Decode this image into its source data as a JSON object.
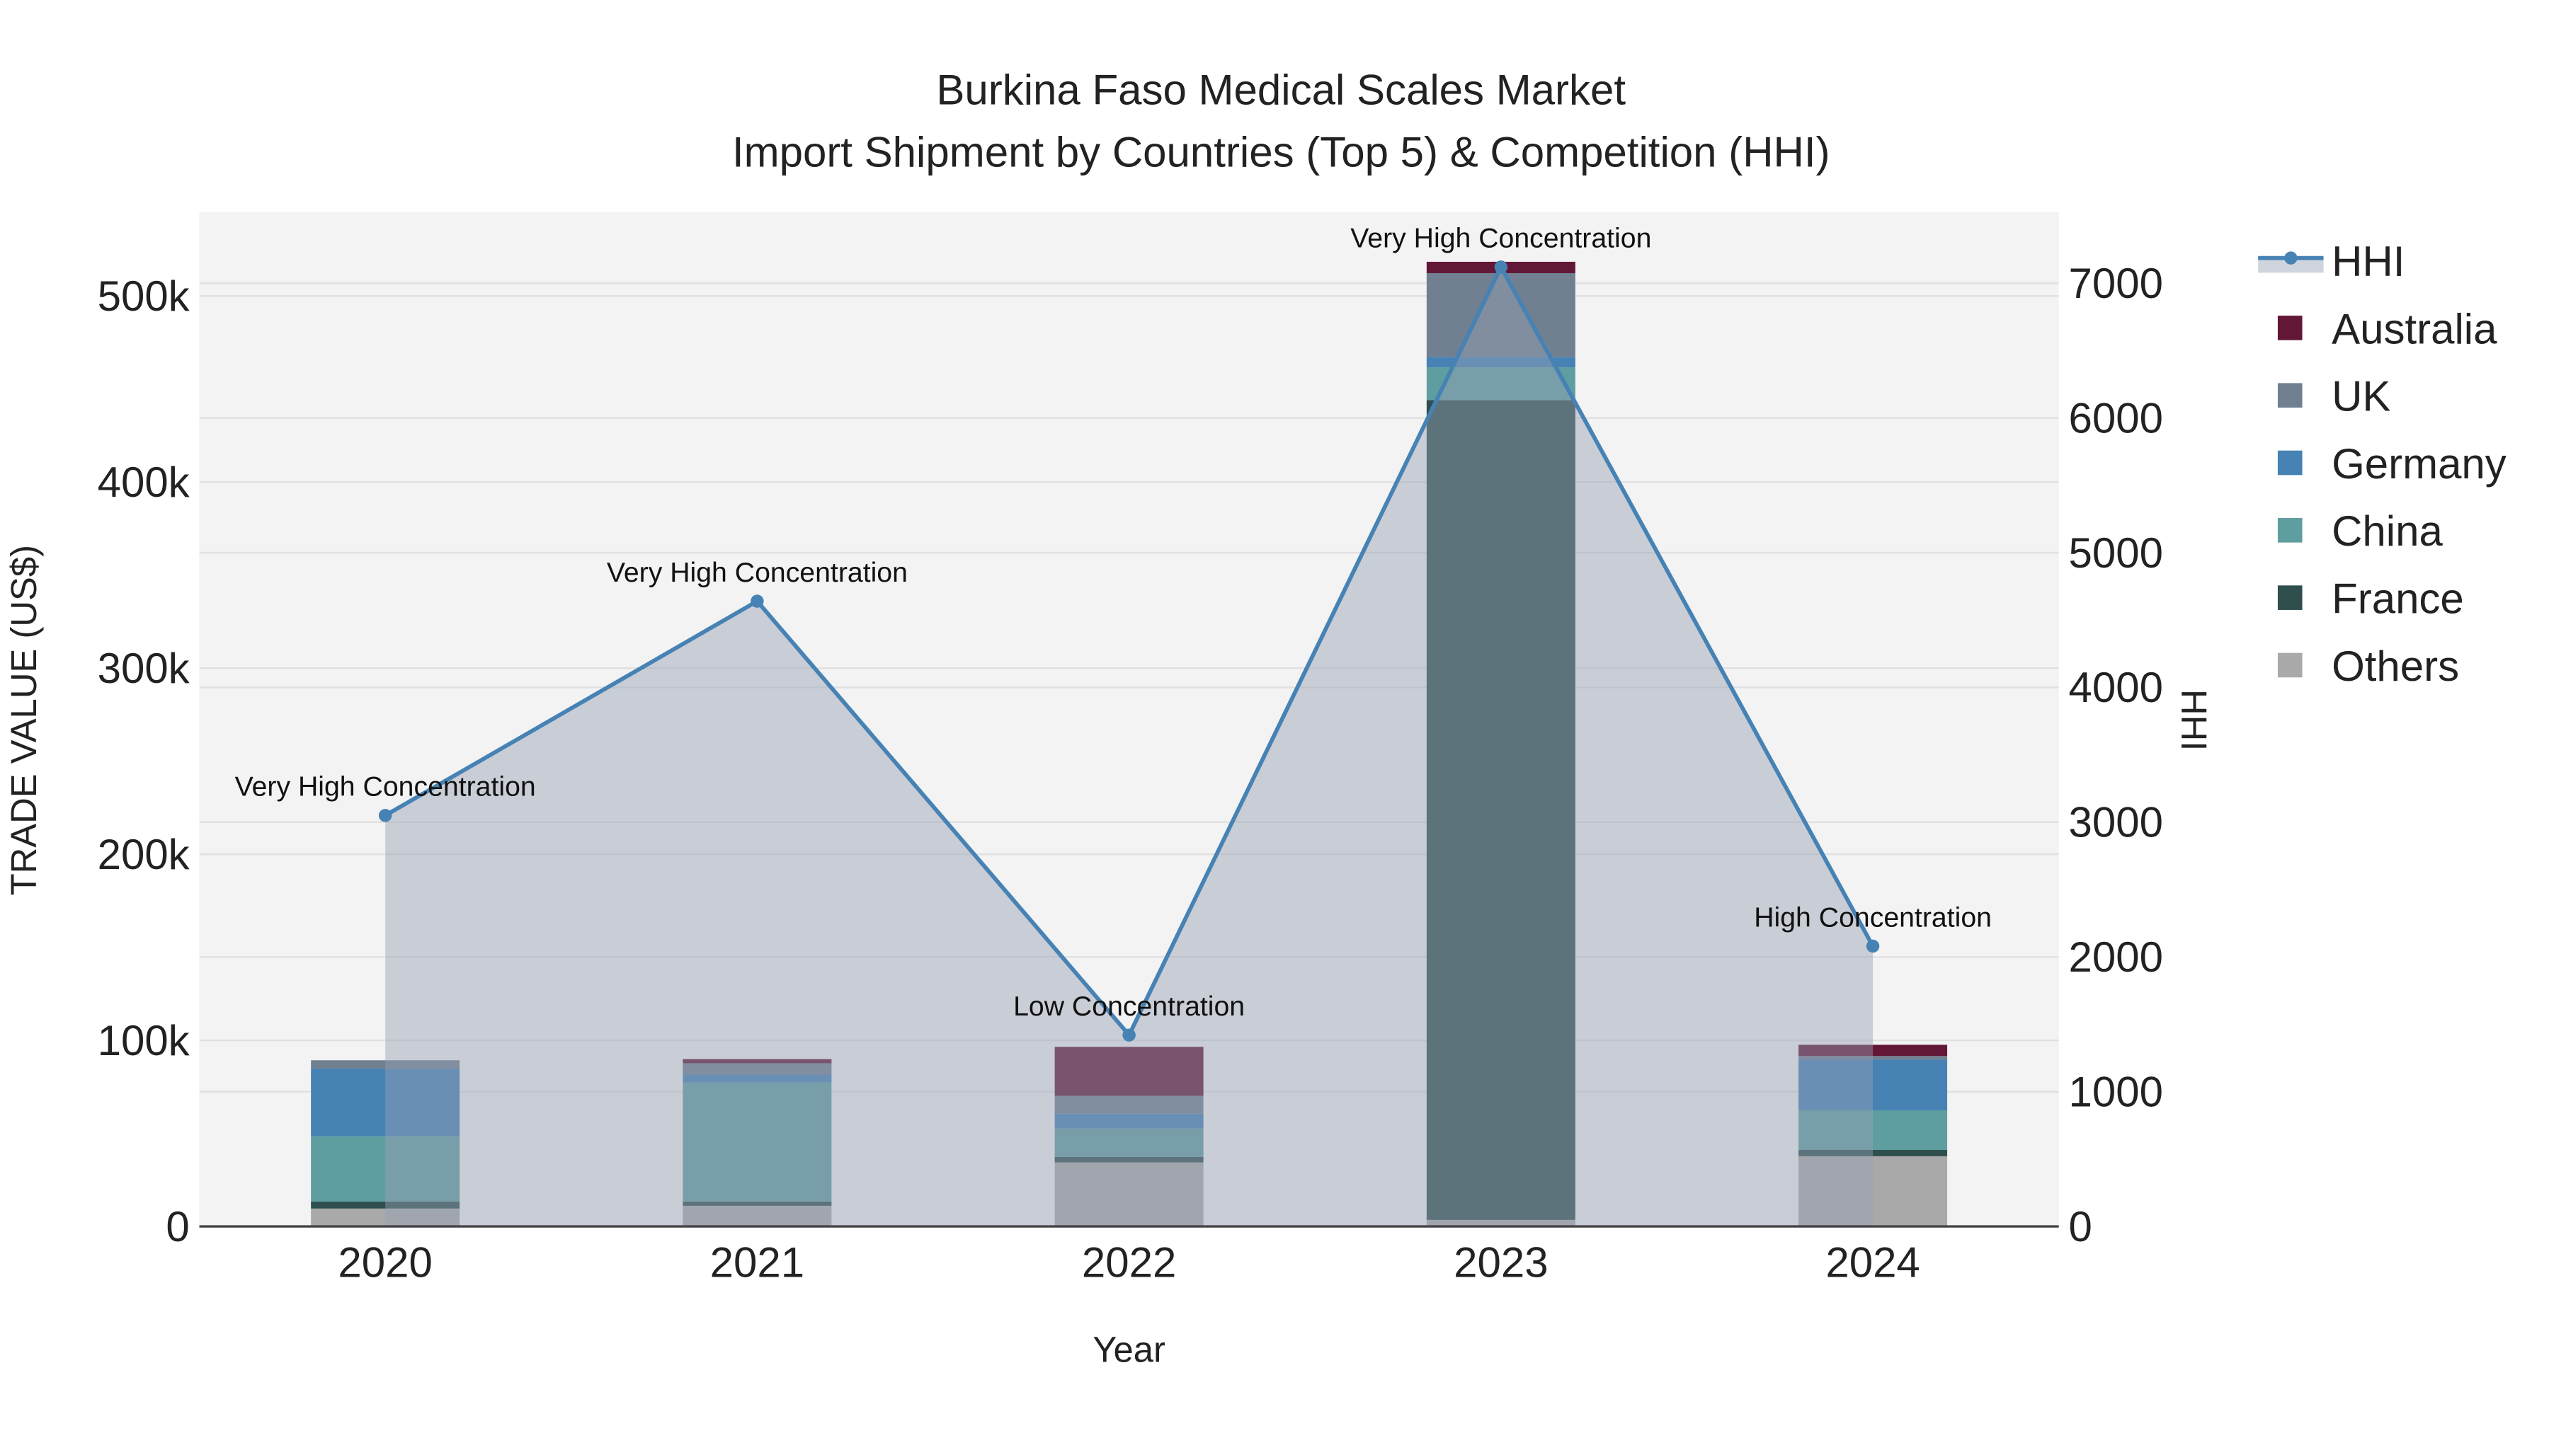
{
  "chart_data": {
    "type": "bar",
    "title": "Burkina Faso Medical Scales Market",
    "subtitle": "Import Shipment by Countries (Top 5) & Competition (HHI)",
    "xlabel": "Year",
    "ylabel": "TRADE VALUE (US$)",
    "y2label": "HHI",
    "categories": [
      "2020",
      "2021",
      "2022",
      "2023",
      "2024"
    ],
    "ylim": [
      0,
      545000
    ],
    "y2lim": [
      0,
      7526
    ],
    "yticks": [
      {
        "v": 0,
        "label": "0"
      },
      {
        "v": 100000,
        "label": "100k"
      },
      {
        "v": 200000,
        "label": "200k"
      },
      {
        "v": 300000,
        "label": "300k"
      },
      {
        "v": 400000,
        "label": "400k"
      },
      {
        "v": 500000,
        "label": "500k"
      }
    ],
    "y2ticks": [
      {
        "v": 0,
        "label": "0"
      },
      {
        "v": 1000,
        "label": "1000"
      },
      {
        "v": 2000,
        "label": "2000"
      },
      {
        "v": 3000,
        "label": "3000"
      },
      {
        "v": 4000,
        "label": "4000"
      },
      {
        "v": 5000,
        "label": "5000"
      },
      {
        "v": 6000,
        "label": "6000"
      },
      {
        "v": 7000,
        "label": "7000"
      }
    ],
    "series": [
      {
        "name": "Others",
        "color": "#a9a9a9",
        "values": [
          9600,
          11100,
          34400,
          3500,
          37700
        ]
      },
      {
        "name": "France",
        "color": "#2f4f4f",
        "values": [
          3800,
          2300,
          2900,
          440600,
          3400
        ]
      },
      {
        "name": "China",
        "color": "#5f9ea0",
        "values": [
          35000,
          64000,
          15300,
          17600,
          21300
        ]
      },
      {
        "name": "Germany",
        "color": "#4682b4",
        "values": [
          36400,
          4200,
          8000,
          5600,
          27200
        ]
      },
      {
        "name": "UK",
        "color": "#708090",
        "values": [
          4500,
          6100,
          9600,
          45000,
          2000
        ]
      },
      {
        "name": "Australia",
        "color": "#621737",
        "values": [
          0,
          2200,
          26300,
          6100,
          6000
        ]
      }
    ],
    "hhi": {
      "name": "HHI",
      "color": "#4682b4",
      "values": [
        3050,
        4640,
        1420,
        7120,
        2080
      ],
      "annotations": [
        "Very High Concentration",
        "Very High Concentration",
        "Low Concentration",
        "Very High Concentration",
        "High Concentration"
      ]
    },
    "legend_order": [
      "HHI",
      "Australia",
      "UK",
      "Germany",
      "China",
      "France",
      "Others"
    ],
    "legend_placement": "right",
    "grid": true
  }
}
